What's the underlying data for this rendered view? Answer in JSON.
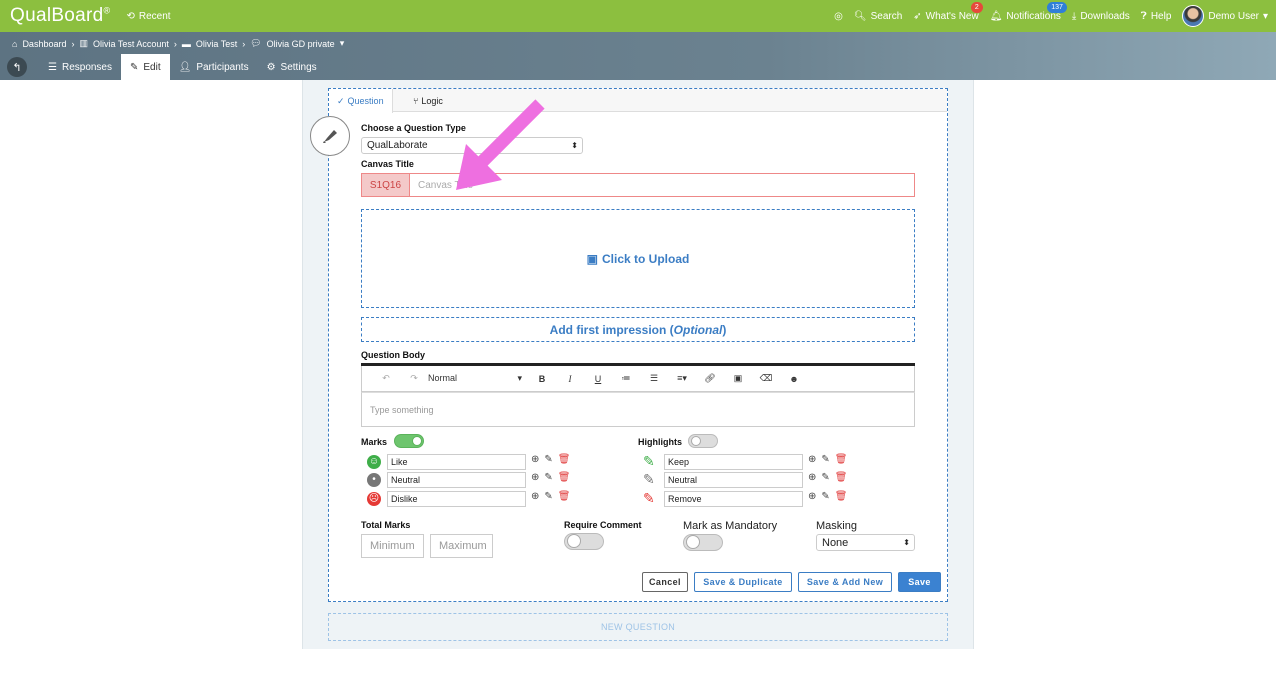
{
  "app": {
    "logo": "QualBoard",
    "reg": "®",
    "recent": "Recent"
  },
  "topnav": {
    "search": "Search",
    "whats_new": "What's New",
    "whats_new_badge": "2",
    "notifications": "Notifications",
    "notifications_badge": "137",
    "downloads": "Downloads",
    "help": "Help",
    "user": "Demo User"
  },
  "breadcrumb": [
    "Dashboard",
    "Olivia Test Account",
    "Olivia Test",
    "Olivia GD private"
  ],
  "tabs": {
    "responses": "Responses",
    "edit": "Edit",
    "participants": "Participants",
    "settings": "Settings"
  },
  "question_tabs": {
    "question": "Question",
    "logic": "Logic"
  },
  "form": {
    "type_label": "Choose a Question Type",
    "type_value": "QualLaborate",
    "canvas_label": "Canvas Title",
    "prefix": "S1Q16",
    "canvas_placeholder": "Canvas Title",
    "upload": "Click to Upload",
    "impression": "Add first impression (",
    "impression_optional": "Optional",
    "impression_end": ")",
    "body_label": "Question Body",
    "toolbar_style": "Normal",
    "body_placeholder": "Type something"
  },
  "marks": {
    "label": "Marks",
    "items": [
      {
        "label": "Like",
        "color": "#3fae49"
      },
      {
        "label": "Neutral",
        "color": "#777777"
      },
      {
        "label": "Dislike",
        "color": "#e53935"
      }
    ]
  },
  "highlights": {
    "label": "Highlights",
    "items": [
      {
        "label": "Keep",
        "color": "#3fae49"
      },
      {
        "label": "Neutral",
        "color": "#777777"
      },
      {
        "label": "Remove",
        "color": "#e53935"
      }
    ]
  },
  "options": {
    "total_marks": "Total Marks",
    "min_placeholder": "Minimum",
    "max_placeholder": "Maximum",
    "require_comment": "Require Comment",
    "mandatory": "Mark as Mandatory",
    "masking": "Masking",
    "masking_value": "None"
  },
  "buttons": {
    "cancel": "Cancel",
    "save_duplicate": "Save & Duplicate",
    "save_add_new": "Save & Add New",
    "save": "Save"
  },
  "new_question": "NEW QUESTION",
  "colors": {
    "brand_green": "#8cbf3f",
    "accent_blue": "#3b7dc4",
    "arrow_pink": "#ee6fe0"
  }
}
